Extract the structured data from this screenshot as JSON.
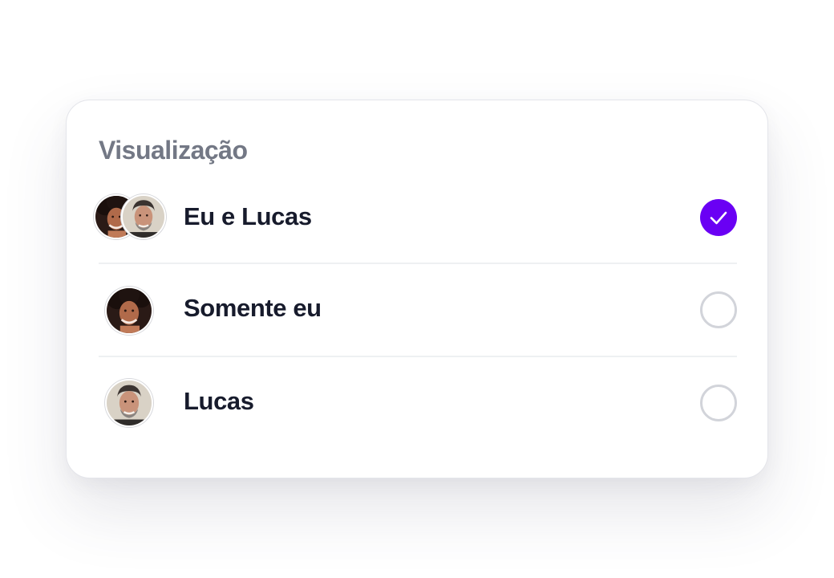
{
  "panel": {
    "title": "Visualização"
  },
  "options": [
    {
      "label": "Eu e Lucas",
      "selected": true,
      "avatars": [
        "woman-avatar",
        "man-avatar"
      ]
    },
    {
      "label": "Somente eu",
      "selected": false,
      "avatars": [
        "woman-avatar"
      ]
    },
    {
      "label": "Lucas",
      "selected": false,
      "avatars": [
        "man-avatar"
      ]
    }
  ],
  "colors": {
    "accent": "#6a00f4",
    "title": "#737885",
    "label": "#171b2c",
    "radio_border": "#d2d4da",
    "divider": "#eef0f2"
  },
  "icons": {
    "selected": "check-icon"
  }
}
